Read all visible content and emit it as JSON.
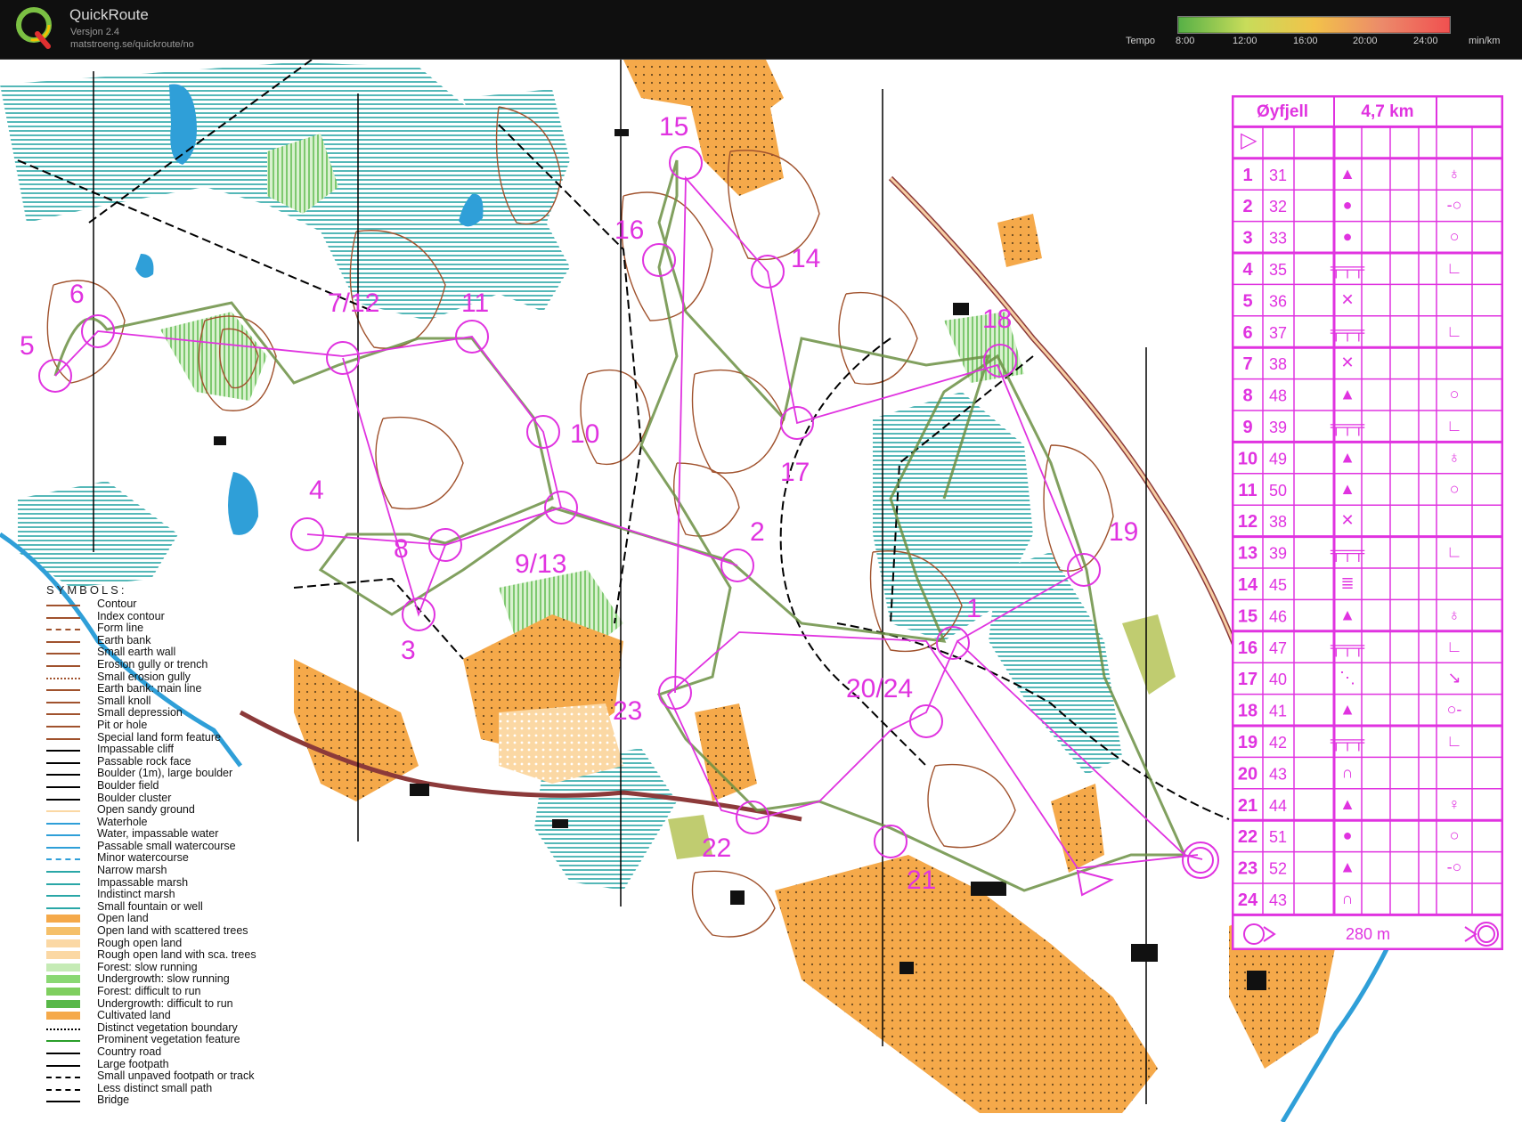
{
  "app": {
    "title": "QuickRoute",
    "version": "Versjon 2.4",
    "url": "matstroeng.se/quickroute/no",
    "logo_letter": "Q"
  },
  "tempo": {
    "label": "Tempo",
    "ticks": [
      "8:00",
      "12:00",
      "16:00",
      "20:00",
      "24:00"
    ],
    "unit": "min/km",
    "colors": [
      "#56b046",
      "#c8dc5a",
      "#f2c24a",
      "#ec8a6a",
      "#f05050"
    ]
  },
  "map": {
    "colors": {
      "course": "#e033e0",
      "forest": "#ffffff",
      "open": "#f5a94a",
      "rough": "#fbd8a4",
      "green": "#7fcf5f",
      "marsh": "#2aa7a7",
      "water": "#2f9fd8",
      "contour": "#a0522d",
      "route": "#6b8f43"
    },
    "control_labels": [
      "5",
      "6",
      "7/12",
      "11",
      "10",
      "4",
      "8",
      "9/13",
      "3",
      "16",
      "15",
      "14",
      "17",
      "2",
      "1",
      "18",
      "19",
      "20/24",
      "23",
      "22",
      "21"
    ]
  },
  "legend": {
    "title": "SYMBOLS:",
    "items": [
      "Contour",
      "Index contour",
      "Form line",
      "Earth bank",
      "Small earth wall",
      "Erosion gully or trench",
      "Small erosion gully",
      "Earth bank: main line",
      "Small knoll",
      "Small depression",
      "Pit or hole",
      "Special land form feature",
      "Impassable cliff",
      "Passable rock face",
      "Boulder (1m), large boulder",
      "Boulder field",
      "Boulder cluster",
      "Open sandy ground",
      "Waterhole",
      "Water, impassable water",
      "Passable small watercourse",
      "Minor watercourse",
      "Narrow marsh",
      "Impassable marsh",
      "Indistinct marsh",
      "Small fountain or well",
      "Open land",
      "Open land with scattered trees",
      "Rough open land",
      "Rough open land with sca. trees",
      "Forest: slow running",
      "Undergrowth: slow running",
      "Forest: difficult to run",
      "Undergrowth: difficult to run",
      "Cultivated land",
      "Distinct vegetation boundary",
      "Prominent vegetation feature",
      "Country road",
      "Large footpath",
      "Small unpaved footpath or track",
      "Less distinct small path",
      "Bridge"
    ]
  },
  "control_descriptions": {
    "event": "Øyfjell",
    "length": "4,7 km",
    "start_symbol": "▷",
    "rows": [
      {
        "num": "1",
        "code": "31",
        "feature": "▲",
        "where": "♁"
      },
      {
        "num": "2",
        "code": "32",
        "feature": "●",
        "where": "-○"
      },
      {
        "num": "3",
        "code": "33",
        "feature": "●",
        "where": "○"
      },
      {
        "num": "4",
        "code": "35",
        "feature": "╤╤╤",
        "where": "∟"
      },
      {
        "num": "5",
        "code": "36",
        "feature": "✕",
        "where": ""
      },
      {
        "num": "6",
        "code": "37",
        "feature": "╤╤╤",
        "where": "∟"
      },
      {
        "num": "7",
        "code": "38",
        "feature": "✕",
        "where": ""
      },
      {
        "num": "8",
        "code": "48",
        "feature": "▲",
        "where": "○"
      },
      {
        "num": "9",
        "code": "39",
        "feature": "╤╤╤",
        "where": "∟"
      },
      {
        "num": "10",
        "code": "49",
        "feature": "▲",
        "where": "♁"
      },
      {
        "num": "11",
        "code": "50",
        "feature": "▲",
        "where": "○"
      },
      {
        "num": "12",
        "code": "38",
        "feature": "✕",
        "where": ""
      },
      {
        "num": "13",
        "code": "39",
        "feature": "╤╤╤",
        "where": "∟"
      },
      {
        "num": "14",
        "code": "45",
        "feature": "≣",
        "where": ""
      },
      {
        "num": "15",
        "code": "46",
        "feature": "▲",
        "where": "♁"
      },
      {
        "num": "16",
        "code": "47",
        "feature": "╤╤╤",
        "where": "∟"
      },
      {
        "num": "17",
        "code": "40",
        "feature": "⋱",
        "where": "↘"
      },
      {
        "num": "18",
        "code": "41",
        "feature": "▲",
        "where": "○-"
      },
      {
        "num": "19",
        "code": "42",
        "feature": "╤╤╤",
        "where": "∟"
      },
      {
        "num": "20",
        "code": "43",
        "feature": "∩",
        "where": ""
      },
      {
        "num": "21",
        "code": "44",
        "feature": "▲",
        "where": "♀"
      },
      {
        "num": "22",
        "code": "51",
        "feature": "●",
        "where": "○"
      },
      {
        "num": "23",
        "code": "52",
        "feature": "▲",
        "where": "-○"
      },
      {
        "num": "24",
        "code": "43",
        "feature": "∩",
        "where": ""
      }
    ],
    "finish_distance": "280 m"
  }
}
